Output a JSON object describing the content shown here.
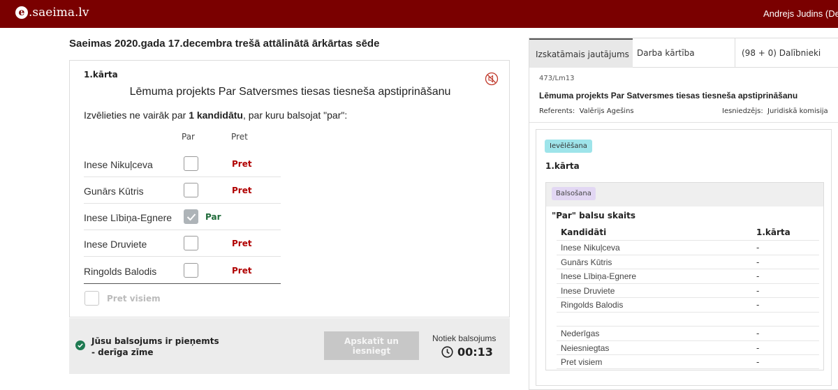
{
  "header": {
    "logo_letter": "e",
    "logo_text": ".saeima.lv",
    "user": "Andrejs Judins (Deputāts)"
  },
  "session_title": "Saeimas 2020.gada 17.decembra trešā attālinātā ārkārtas sēde",
  "ballot": {
    "round": "1.kārta",
    "question": "Lēmuma projekts Par Satversmes tiesas tiesneša apstiprināšanu",
    "instruction_prefix": "Izvēlieties ne vairāk par ",
    "instruction_bold": "1 kandidātu",
    "instruction_suffix": ", par kuru balsojat \"par\":",
    "col_par": "Par",
    "col_pret": "Pret",
    "candidates": [
      {
        "name": "Inese Nikuļceva",
        "checked": false,
        "choice": "Pret"
      },
      {
        "name": "Gunārs Kūtris",
        "checked": false,
        "choice": "Pret"
      },
      {
        "name": "Inese Lībiņa-Egnere",
        "checked": true,
        "choice": "Par"
      },
      {
        "name": "Inese Druviete",
        "checked": false,
        "choice": "Pret"
      },
      {
        "name": "Ringolds Balodis",
        "checked": false,
        "choice": "Pret"
      }
    ],
    "against_all": "Pret visiem"
  },
  "status": {
    "message": "Jūsu balsojums ir pieņemts - derīga zīme",
    "submit_label": "Apskatīt un iesniegt",
    "voting_label": "Notiek balsojums",
    "timer": "00:13"
  },
  "panel": {
    "tabs": [
      "Izskatāmais jautājums",
      "Darba kārtība",
      "(98 + 0) Dalībnieki"
    ],
    "doc_id": "473/Lm13",
    "title": "Lēmuma projekts Par Satversmes tiesas tiesneša apstiprināšanu",
    "referent_label": "Referents:",
    "referent": "Valērijs Agešins",
    "submitter_label": "Iesniedzējs:",
    "submitter": "Juridiskā komisija",
    "badge_election": "Ievēlēšana",
    "result_round": "1.kārta",
    "badge_voting": "Balsošana",
    "par_count_label": "\"Par\" balsu skaits",
    "col_candidates": "Kandidāti",
    "col_round": "1.kārta",
    "rows": [
      {
        "name": "Inese Nikuļceva",
        "value": "-"
      },
      {
        "name": "Gunārs Kūtris",
        "value": "-"
      },
      {
        "name": "Inese Lībiņa-Egnere",
        "value": "-"
      },
      {
        "name": "Inese Druviete",
        "value": "-"
      },
      {
        "name": "Ringolds Balodis",
        "value": "-"
      },
      {
        "name": "",
        "value": ""
      },
      {
        "name": "Nederīgas",
        "value": "-"
      },
      {
        "name": "Neiesniegtas",
        "value": "-"
      },
      {
        "name": "Pret visiem",
        "value": "-"
      }
    ]
  },
  "colors": {
    "brand": "#7a0000",
    "pret": "#b00000",
    "par": "#1f6b3a"
  }
}
